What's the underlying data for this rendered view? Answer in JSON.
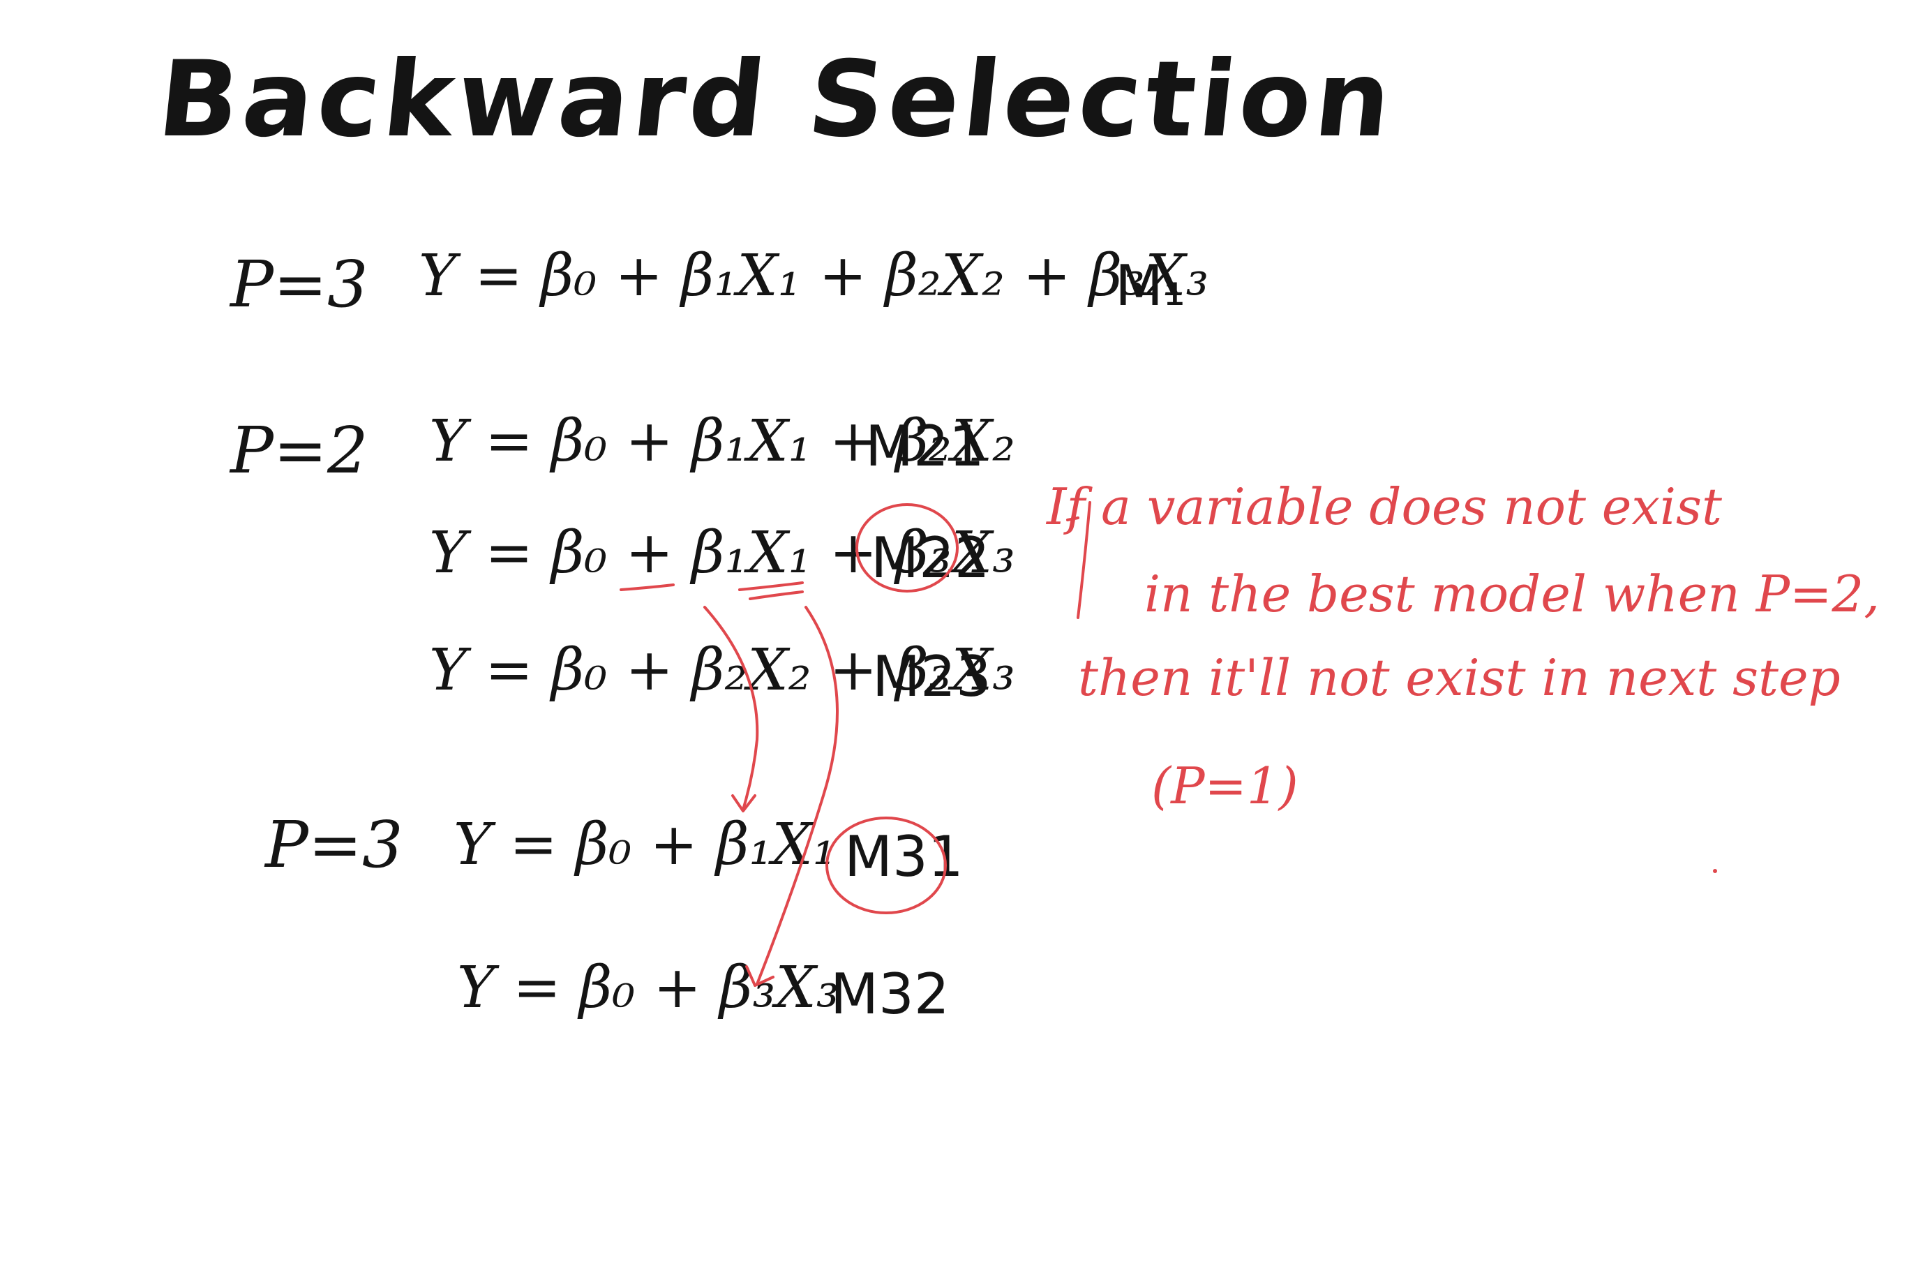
{
  "title": "Backward Selection",
  "steps": [
    {
      "label": "P=3",
      "models": [
        {
          "equation": "Y = β₀ + β₁X₁ + β₂X₂ + β₃X₃",
          "name": "M₁",
          "selected": false
        }
      ]
    },
    {
      "label": "P=2",
      "models": [
        {
          "equation": "Y = β₀ + β₁X₁ + β₂X₂",
          "name": "M21",
          "selected": false
        },
        {
          "equation": "Y = β₀ + β₁X₁ + β₃X₃",
          "name": "M22",
          "selected": true
        },
        {
          "equation": "Y = β₀ + β₂X₂ + β₃X₃",
          "name": "M23",
          "selected": false
        }
      ]
    },
    {
      "label": "P=3",
      "models": [
        {
          "equation": "Y = β₀ + β₁X₁",
          "name": "M31",
          "selected": true
        },
        {
          "equation": "Y = β₀ + β₃X₃",
          "name": "M32",
          "selected": false
        }
      ]
    }
  ],
  "note": {
    "lines": [
      "If a variable does not exist",
      "in the best model when P=2,",
      "then it'll not exist in next step",
      "(P=1)"
    ]
  },
  "colors": {
    "ink": "#141414",
    "annotation": "#e0474c",
    "background": "#ffffff"
  }
}
